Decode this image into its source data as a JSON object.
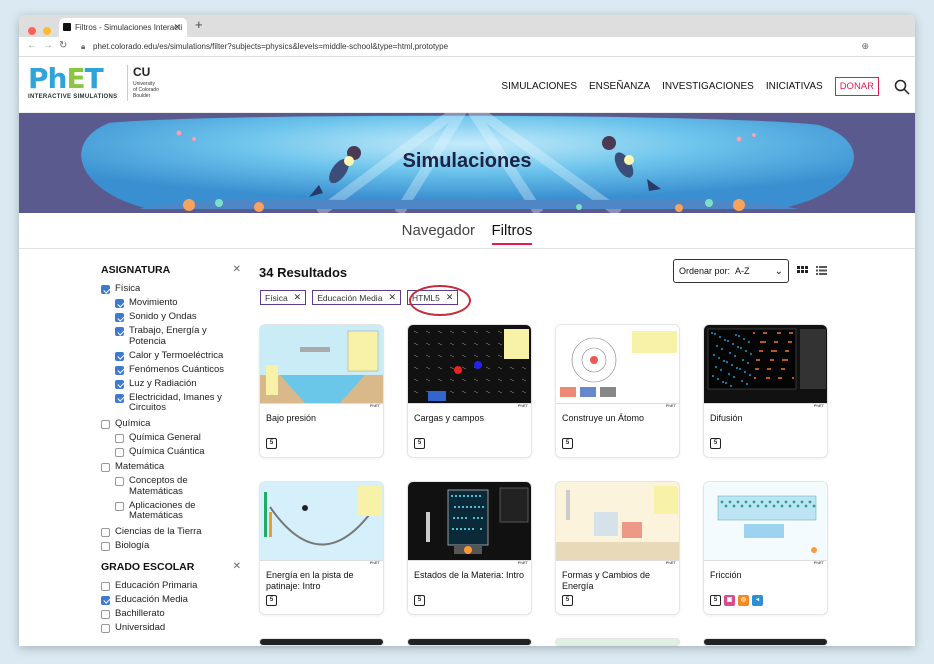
{
  "browser": {
    "tab_title": "Filtros - Simulaciones Interacti",
    "url": "phet.colorado.edu/es/simulations/filter?subjects=physics&levels=middle-school&type=html,prototype"
  },
  "header": {
    "logo_p": "Ph",
    "logo_e": "E",
    "logo_t": "T",
    "logo_sub": "INTERACTIVE SIMULATIONS",
    "cu_lines": [
      "University",
      "of Colorado",
      "Boulder"
    ],
    "nav": [
      "SIMULACIONES",
      "ENSEÑANZA",
      "INVESTIGACIONES",
      "INICIATIVAS"
    ],
    "donate": "DONAR"
  },
  "banner": {
    "title": "Simulaciones"
  },
  "view_tabs": {
    "browser": "Navegador",
    "filters": "Filtros"
  },
  "sidebar": {
    "subject_title": "ASIGNATURA",
    "subject_items": [
      {
        "label": "Física",
        "checked": true,
        "level": 1
      },
      {
        "label": "Movimiento",
        "checked": true,
        "level": 2
      },
      {
        "label": "Sonido y Ondas",
        "checked": true,
        "level": 2
      },
      {
        "label": "Trabajo, Energía y Potencia",
        "checked": true,
        "level": 2
      },
      {
        "label": "Calor y Termoeléctrica",
        "checked": true,
        "level": 2
      },
      {
        "label": "Fenómenos Cuánticos",
        "checked": true,
        "level": 2
      },
      {
        "label": "Luz y Radiación",
        "checked": true,
        "level": 2
      },
      {
        "label": "Electricidad, Imanes y Circuitos",
        "checked": true,
        "level": 2
      },
      {
        "label": "Química",
        "checked": false,
        "level": 1
      },
      {
        "label": "Química General",
        "checked": false,
        "level": 2
      },
      {
        "label": "Química Cuántica",
        "checked": false,
        "level": 2
      },
      {
        "label": "Matemática",
        "checked": false,
        "level": 1
      },
      {
        "label": "Conceptos de Matemáticas",
        "checked": false,
        "level": 2
      },
      {
        "label": "Aplicaciones de Matemáticas",
        "checked": false,
        "level": 2
      },
      {
        "label": "Ciencias de la Tierra",
        "checked": false,
        "level": 1
      },
      {
        "label": "Biología",
        "checked": false,
        "level": 1
      }
    ],
    "grade_title": "GRADO ESCOLAR",
    "grade_items": [
      {
        "label": "Educación Primaria",
        "checked": false
      },
      {
        "label": "Educación Media",
        "checked": true
      },
      {
        "label": "Bachillerato",
        "checked": false
      },
      {
        "label": "Universidad",
        "checked": false
      }
    ]
  },
  "results": {
    "count_label": "34 Resultados",
    "chips": [
      "Física",
      "Educación Media",
      "HTML5"
    ],
    "sort_label": "Ordenar por:",
    "sort_value": "A-Z"
  },
  "cards": [
    {
      "title": "Bajo presión",
      "badges": [
        "html5"
      ]
    },
    {
      "title": "Cargas y campos",
      "badges": [
        "html5"
      ]
    },
    {
      "title": "Construye un Átomo",
      "badges": [
        "html5"
      ]
    },
    {
      "title": "Difusión",
      "badges": [
        "html5"
      ]
    },
    {
      "title": "Energía en la pista de patinaje: Intro",
      "badges": [
        "html5"
      ]
    },
    {
      "title": "Estados de la Materia: Intro",
      "badges": [
        "html5"
      ]
    },
    {
      "title": "Formas y Cambios de Energía",
      "badges": [
        "html5"
      ]
    },
    {
      "title": "Fricción",
      "badges": [
        "html5",
        "pink",
        "orange",
        "blue"
      ]
    }
  ],
  "colors": {
    "accent": "#e21c4f",
    "chip_border": "#5c3c8e",
    "checkbox": "#3f7ad0",
    "highlight_ring": "#c42d3a"
  }
}
